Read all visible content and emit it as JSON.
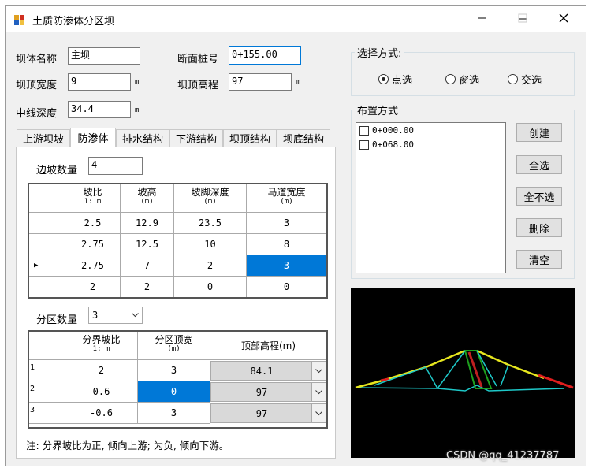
{
  "window": {
    "title": "土质防渗体分区坝"
  },
  "fields": {
    "dam_name_label": "坝体名称",
    "dam_name_value": "主坝",
    "section_label": "断面桩号",
    "section_value": "0+155.00",
    "crest_width_label": "坝顶宽度",
    "crest_width_value": "9",
    "crest_width_unit": "m",
    "crest_elev_label": "坝顶高程",
    "crest_elev_value": "97",
    "crest_elev_unit": "m",
    "centerline_label": "中线深度",
    "centerline_value": "34.4",
    "centerline_unit": "m"
  },
  "select_mode": {
    "title": "选择方式:",
    "options": [
      "点选",
      "窗选",
      "交选"
    ],
    "selected": "点选"
  },
  "layout_mode": {
    "title": "布置方式",
    "items": [
      "0+000.00",
      "0+068.00"
    ],
    "buttons": [
      "创建",
      "全选",
      "全不选",
      "删除",
      "清空"
    ]
  },
  "tabs": [
    "上游坝坡",
    "防渗体",
    "排水结构",
    "下游结构",
    "坝顶结构",
    "坝底结构"
  ],
  "active_tab": "防渗体",
  "slope": {
    "count_label": "边坡数量",
    "count_value": "4",
    "columns": [
      {
        "label": "坡比",
        "sub": "1: m"
      },
      {
        "label": "坡高",
        "sub": "(m)"
      },
      {
        "label": "坡脚深度",
        "sub": "(m)"
      },
      {
        "label": "马道宽度",
        "sub": "(m)"
      }
    ],
    "row_marker": "▶",
    "rows": [
      [
        "2.5",
        "12.9",
        "23.5",
        "3"
      ],
      [
        "2.75",
        "12.5",
        "10",
        "8"
      ],
      [
        "2.75",
        "7",
        "2",
        "3"
      ],
      [
        "2",
        "2",
        "0",
        "0"
      ]
    ]
  },
  "zone": {
    "count_label": "分区数量",
    "count_value": "3",
    "columns": [
      {
        "label": "分界坡比",
        "sub": "1: m"
      },
      {
        "label": "分区顶宽",
        "sub": "(m)"
      },
      {
        "label": "顶部高程(m)",
        "sub": ""
      }
    ],
    "rows": [
      {
        "index": "1",
        "ratio": "2",
        "width": "3",
        "elev": "84.1"
      },
      {
        "index": "2",
        "ratio": "0.6",
        "width": "0",
        "elev": "97"
      },
      {
        "index": "3",
        "ratio": "-0.6",
        "width": "3",
        "elev": "97"
      }
    ]
  },
  "note": "注: 分界坡比为正, 倾向上游; 为负, 倾向下游。",
  "watermark": "CSDN @qq_41237787",
  "colors": {
    "selection": "#0078d7",
    "preview_bg": "#000000",
    "line_yellow": "#e6e61e",
    "line_cyan": "#1ec8c8",
    "line_red": "#e01e1e",
    "line_green": "#1ea01e"
  }
}
